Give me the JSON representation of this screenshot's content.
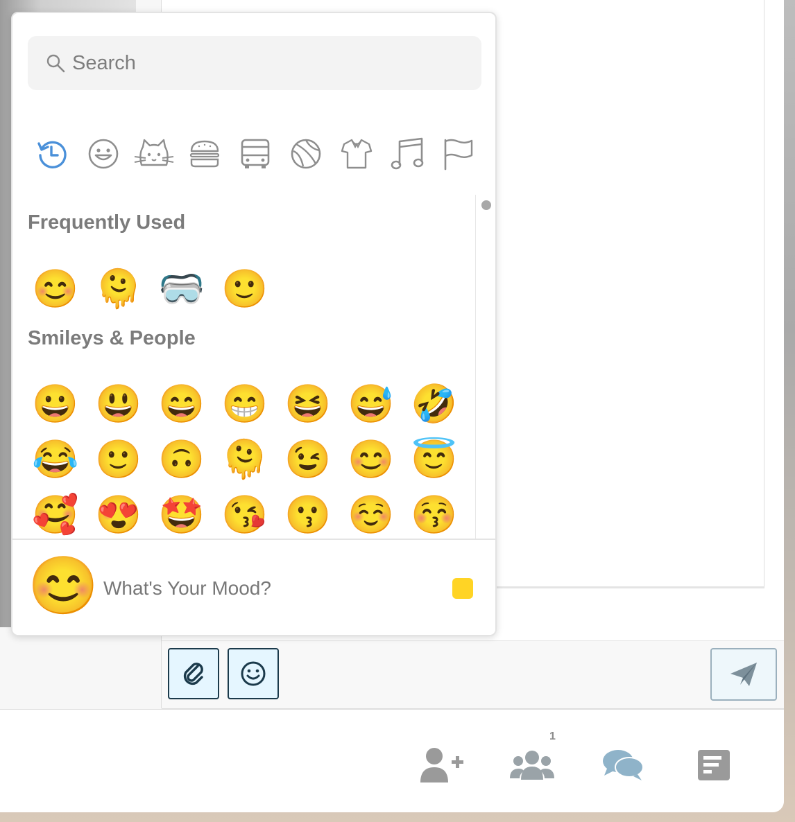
{
  "search": {
    "placeholder": "Search"
  },
  "categories": [
    {
      "name": "recent-icon",
      "active": true
    },
    {
      "name": "smiley-icon"
    },
    {
      "name": "cat-icon"
    },
    {
      "name": "burger-icon"
    },
    {
      "name": "bus-icon"
    },
    {
      "name": "ball-icon"
    },
    {
      "name": "tshirt-icon"
    },
    {
      "name": "music-note-icon"
    },
    {
      "name": "flag-icon"
    }
  ],
  "sections": {
    "frequent": {
      "title": "Frequently Used",
      "emojis": [
        "😊",
        "🫠",
        "🥽",
        "🙂"
      ]
    },
    "smileys": {
      "title": "Smileys & People",
      "emojis": [
        "😀",
        "😃",
        "😄",
        "😁",
        "😆",
        "😅",
        "🤣",
        "😂",
        "🙂",
        "🙃",
        "🫠",
        "😉",
        "😊",
        "😇",
        "🥰",
        "😍",
        "🤩",
        "😘",
        "😗",
        "☺️",
        "😚"
      ]
    }
  },
  "footer": {
    "preview_emoji": "😊",
    "mood_text": "What's Your Mood?",
    "skin_tone_color": "#ffd425"
  },
  "toolbar": {
    "attach_icon": "paperclip-icon",
    "emoji_icon": "smiley-icon",
    "send_icon": "paper-plane-icon"
  },
  "bottom_nav": {
    "participants_badge": "1"
  },
  "colors": {
    "accent": "#4a90d9",
    "icon_gray": "#8e8e8e",
    "nav_gray": "#9aa3a8",
    "nav_blue": "#8fb3c9"
  }
}
